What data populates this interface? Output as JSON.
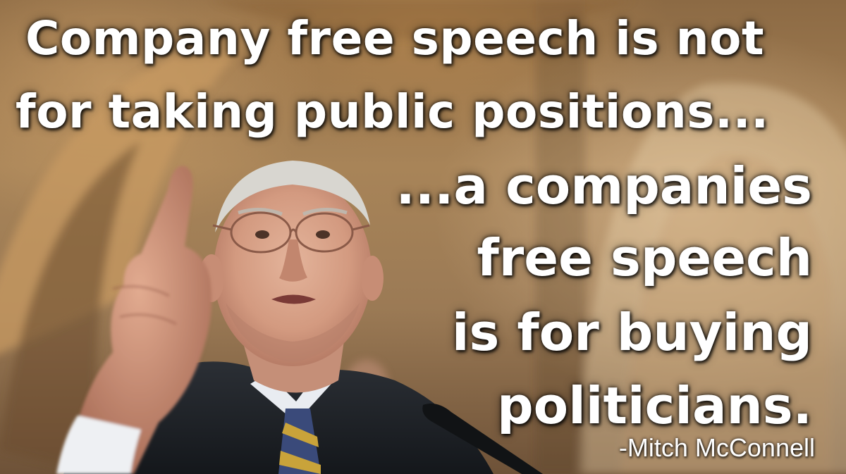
{
  "quote": {
    "lines": [
      "Company free speech is not",
      "for taking public positions...",
      "...a companies",
      "free speech",
      "is for buying",
      "politicians."
    ],
    "attribution": "-Mitch McConnell"
  },
  "photo": {
    "subject": "man-in-suit-pointing-finger-upward",
    "palette": {
      "background_gold": "#a88458",
      "suit_dark": "#1f2226",
      "skin": "#d9a58c",
      "tie_gold": "#c9a33a",
      "tie_blue": "#3a4a7a",
      "text": "#ffffff"
    }
  }
}
